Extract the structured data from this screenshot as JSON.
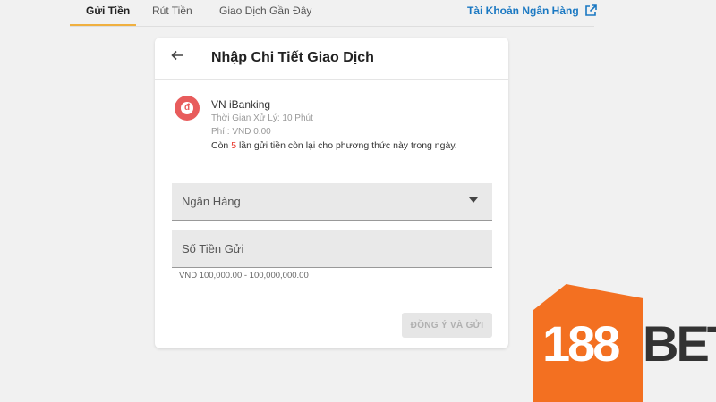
{
  "tabs": [
    {
      "label": "Gửi Tiền",
      "active": true
    },
    {
      "label": "Rút Tiền",
      "active": false
    },
    {
      "label": "Giao Dịch Gần Đây",
      "active": false
    }
  ],
  "bank_account_link": "Tài Khoản Ngân Hàng",
  "card": {
    "title": "Nhập Chi Tiết Giao Dịch",
    "back_icon": "arrow-left-icon",
    "method": {
      "icon": "vn-ibanking-icon",
      "name": "VN iBanking",
      "processing_time": "Thời Gian Xử Lý: 10 Phút",
      "fee": "Phí : VND 0.00",
      "limit_prefix": "Còn ",
      "limit_count": "5",
      "limit_suffix": " lần gửi tiền còn lại cho phương thức này trong ngày."
    },
    "bank_field_label": "Ngân Hàng",
    "amount_field_placeholder": "Số Tiền Gửi",
    "amount_range": "VND 100,000.00 - 100,000,000.00",
    "submit_label": "ĐỒNG Ý VÀ GỬI"
  },
  "logo": {
    "num": "188",
    "bet": "BET"
  },
  "colors": {
    "accent": "#f0b040",
    "link": "#1a78c2",
    "highlight": "#e8372b",
    "brand": "#f37021"
  }
}
